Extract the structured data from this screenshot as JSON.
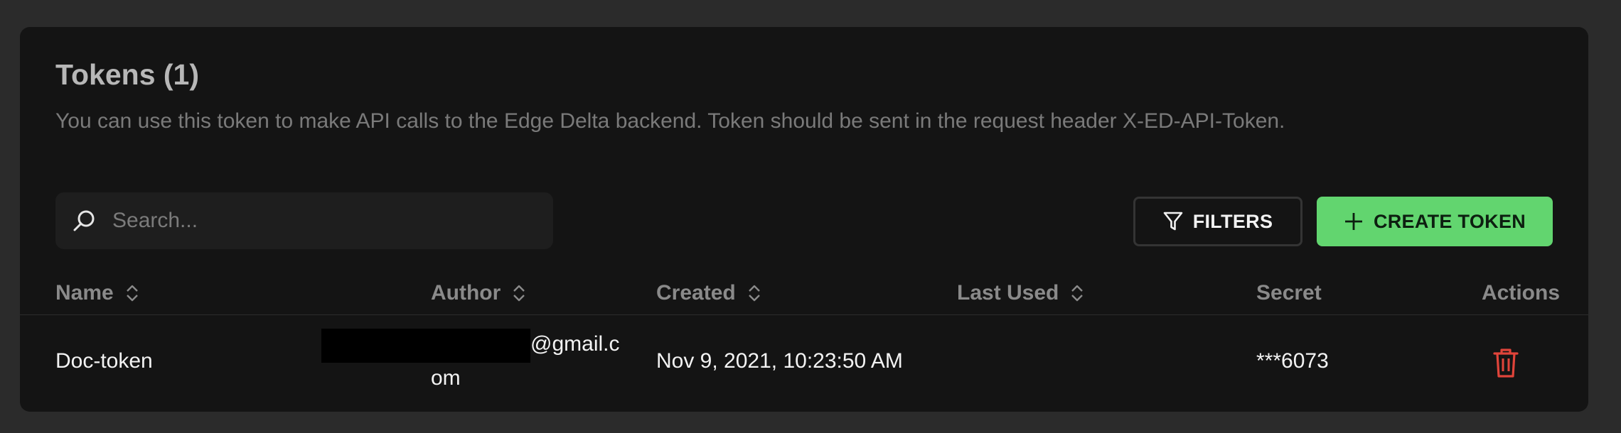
{
  "header": {
    "title": "Tokens (1)",
    "description": "You can use this token to make API calls to the Edge Delta backend. Token should be sent in the request header X-ED-API-Token."
  },
  "search": {
    "placeholder": "Search...",
    "value": ""
  },
  "toolbar": {
    "filters_label": "FILTERS",
    "create_label": "CREATE TOKEN"
  },
  "table": {
    "columns": [
      "Name",
      "Author",
      "Created",
      "Last Used",
      "Secret",
      "Actions"
    ],
    "rows": [
      {
        "name": "Doc-token",
        "author_part1": "@gmail.c",
        "author_part2": "om",
        "created": "Nov 9, 2021, 10:23:50 AM",
        "last_used": "",
        "secret": "***6073"
      }
    ]
  },
  "colors": {
    "accent": "#62d56f",
    "danger": "#e0443a"
  },
  "icons": {
    "search": "search-icon",
    "filters": "filter-icon",
    "create": "plus-icon",
    "sort": "sort-icon",
    "delete": "trash-icon"
  }
}
